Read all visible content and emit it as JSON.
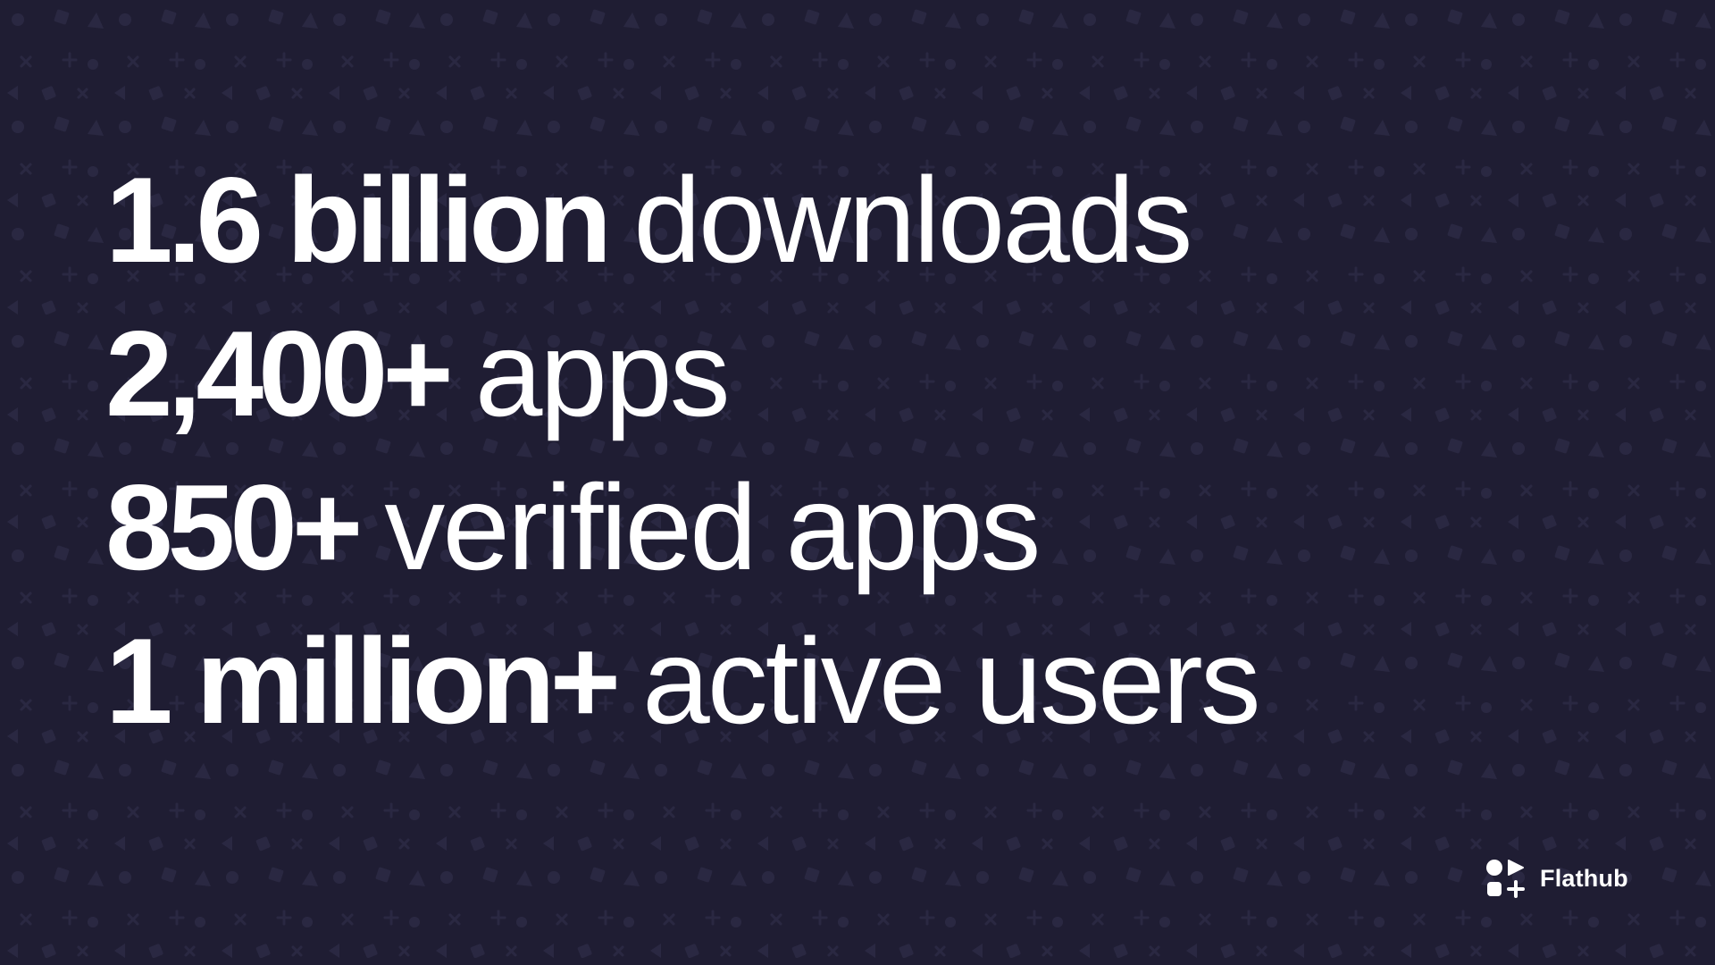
{
  "stats": [
    {
      "value": "1.6 billion",
      "label": "downloads"
    },
    {
      "value": "2,400+",
      "label": "apps"
    },
    {
      "value": "850+",
      "label": "verified apps"
    },
    {
      "value": "1 million+",
      "label": "active users"
    }
  ],
  "brand": {
    "name": "Flathub",
    "icon": "flathub-logo-icon"
  },
  "colors": {
    "background": "#1f1d33",
    "pattern": "#2a2842",
    "text": "#ffffff"
  }
}
